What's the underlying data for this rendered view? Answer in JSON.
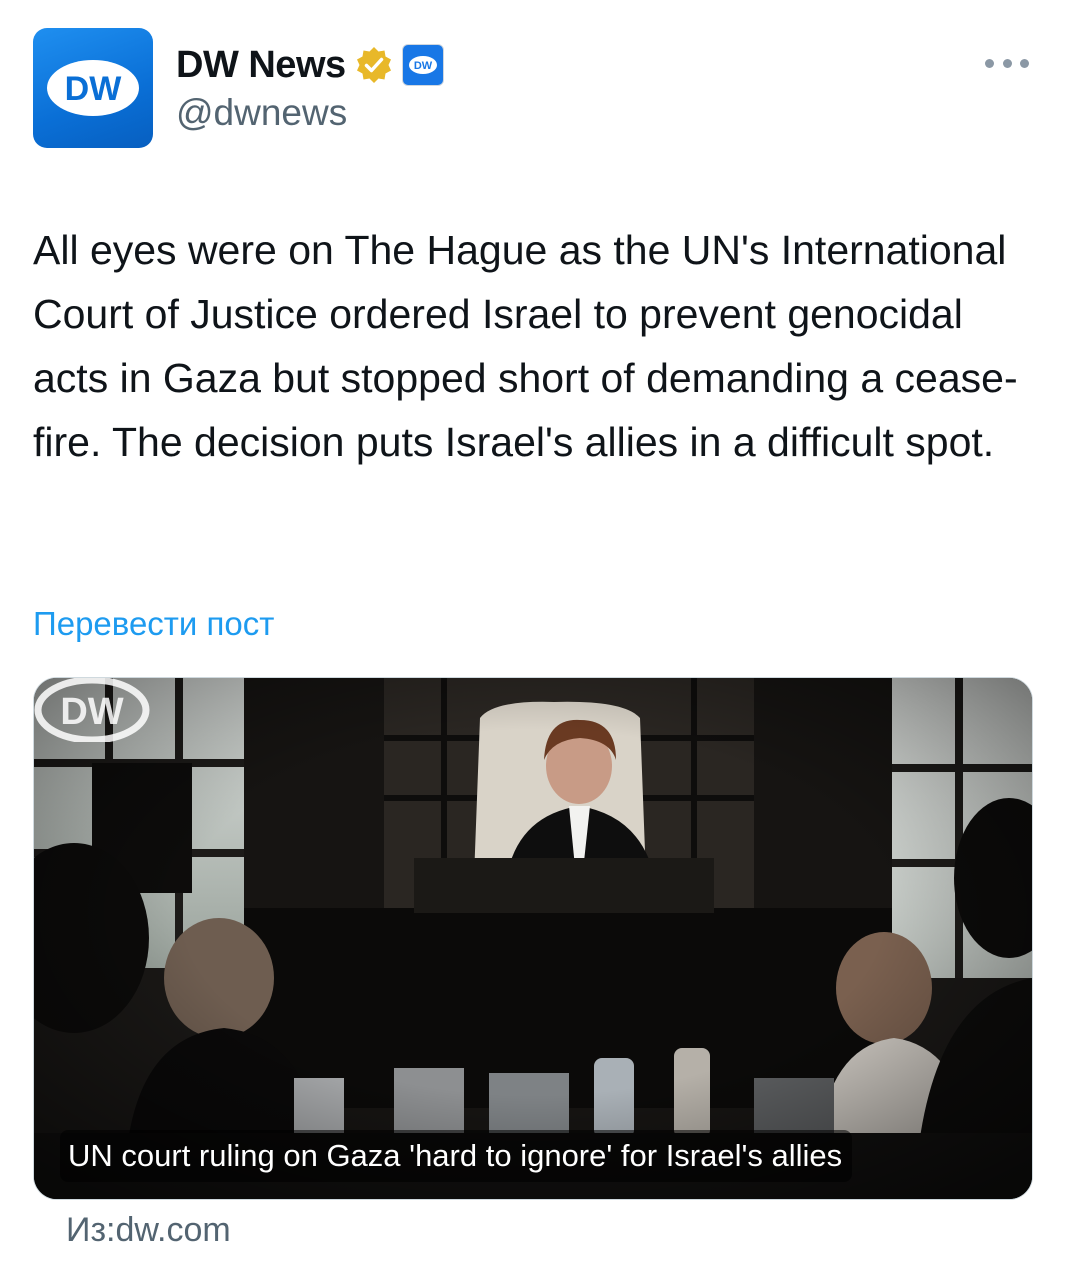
{
  "author": {
    "display_name": "DW News",
    "handle": "@dwnews",
    "avatar_logo_text": "DW",
    "affiliate_badge_text": "DW",
    "verified_badge_color": "#e8b829"
  },
  "tweet": {
    "text": "All eyes were on The Hague as the UN's International Court of Justice ordered Israel to prevent genocidal acts in Gaza but stopped short of demanding a cease-fire. The decision puts Israel's allies in a difficult spot.",
    "translate_label": "Перевести пост"
  },
  "link_card": {
    "title": "UN court ruling on Gaza 'hard to ignore' for Israel's allies",
    "watermark_text": "DW",
    "source_label": "Из:dw.com"
  },
  "colors": {
    "brand_blue": "#0a6fd6",
    "link_blue": "#1d9bf0",
    "secondary_text": "#536471"
  }
}
